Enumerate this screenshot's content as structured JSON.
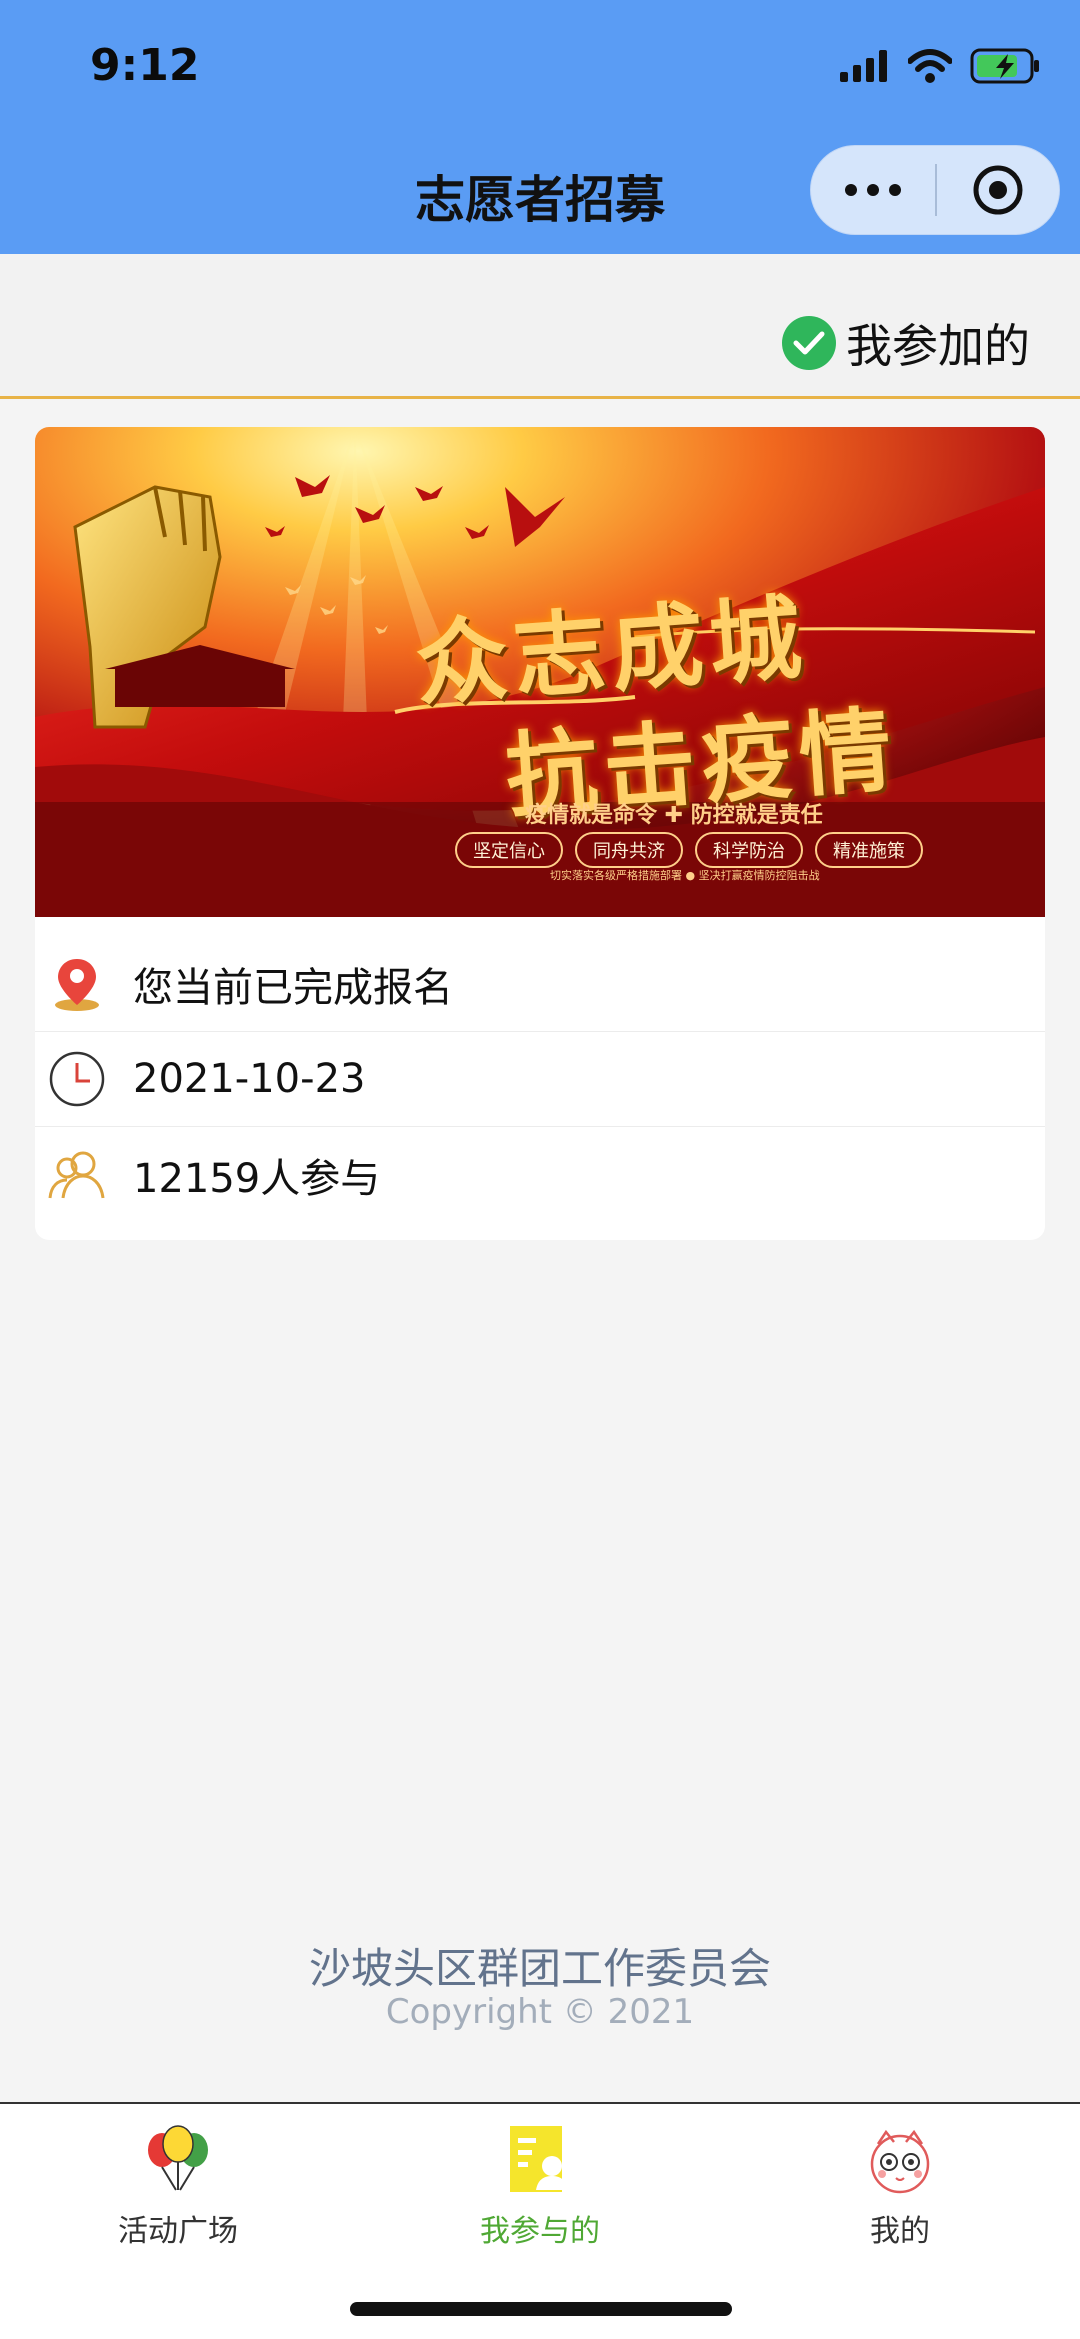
{
  "status_bar": {
    "time": "9:12"
  },
  "nav": {
    "title": "志愿者招募"
  },
  "filter": {
    "label": "我参加的"
  },
  "card": {
    "banner": {
      "title_line1": "众志成城",
      "title_line2": "抗击疫情",
      "slogan": "疫情就是命令 ✚ 防控就是责任",
      "tags": [
        "坚定信心",
        "同舟共济",
        "科学防治",
        "精准施策"
      ],
      "small_text": "切实落实各级严格措施部署  ●  坚决打赢疫情防控阻击战"
    },
    "status": "您当前已完成报名",
    "date": "2021-10-23",
    "participants": "12159人参与"
  },
  "footer": {
    "org": "沙坡头区群团工作委员会",
    "copyright": "Copyright © 2021"
  },
  "tabbar": {
    "tabs": [
      {
        "label": "活动广场",
        "icon": "balloons-icon"
      },
      {
        "label": "我参与的",
        "icon": "document-user-icon",
        "active": true
      },
      {
        "label": "我的",
        "icon": "avatar-face-icon"
      }
    ]
  },
  "colors": {
    "header_bg": "#5a9cf4",
    "accent_line": "#e8b347",
    "active_tab": "#4fa834",
    "check_green": "#2fb65b"
  }
}
